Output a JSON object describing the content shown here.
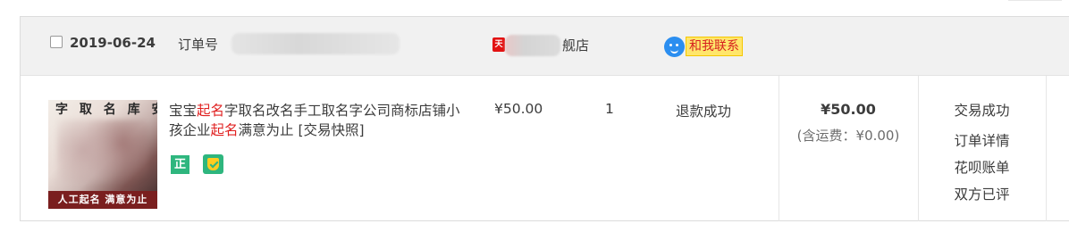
{
  "order": {
    "date": "2019-06-24",
    "order_no_label": "订单号",
    "shop": {
      "icon_label": "天",
      "name_suffix": "舰店"
    },
    "chat_label": "和我联系"
  },
  "product": {
    "thumb_top_text": "字 取 名 库 安",
    "thumb_caption": "人工起名 满意为止",
    "title_parts": [
      "宝宝",
      "起名",
      "字取名改名手工取名字公司商标店铺小孩企业",
      "起名",
      "满意为止"
    ],
    "snapshot_label": "[交易快照]",
    "badge_zheng": "正",
    "unit_price": "¥50.00",
    "quantity": "1",
    "refund_status": "退款成功"
  },
  "payment": {
    "total": "¥50.00",
    "shipping_note": "(含运费：¥0.00)"
  },
  "status": {
    "trade_status": "交易成功",
    "order_detail": "订单详情",
    "huabei_bill": "花呗账单",
    "review_status": "双方已评"
  },
  "colors": {
    "highlight": "#e02020",
    "badge_green": "#2eb67e",
    "chat_blue": "#2b8ef0",
    "chat_bg": "#ffe66b"
  },
  "icons": [
    "checkbox-icon",
    "tmall-shop-icon",
    "chat-icon",
    "zheng-badge-icon",
    "consumer-protection-icon"
  ]
}
